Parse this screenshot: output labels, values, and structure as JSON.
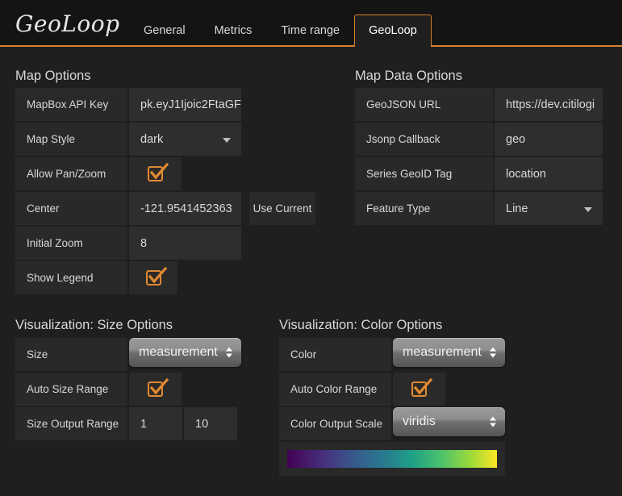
{
  "header": {
    "logo": "GeoLoop",
    "tabs": [
      {
        "label": "General",
        "active": false
      },
      {
        "label": "Metrics",
        "active": false
      },
      {
        "label": "Time range",
        "active": false
      },
      {
        "label": "GeoLoop",
        "active": true
      }
    ]
  },
  "accent_color": "#d9822b",
  "map_options": {
    "title": "Map Options",
    "rows": [
      {
        "label": "MapBox API Key",
        "value": "pk.eyJ1Ijoic2FtaGF"
      },
      {
        "label": "Map Style",
        "value": "dark"
      },
      {
        "label": "Allow Pan/Zoom",
        "checked": true
      },
      {
        "label": "Center",
        "value": "-121.9541452363",
        "button": "Use Current"
      },
      {
        "label": "Initial Zoom",
        "value": "8"
      },
      {
        "label": "Show Legend",
        "checked": true
      }
    ]
  },
  "map_data_options": {
    "title": "Map Data Options",
    "rows": [
      {
        "label": "GeoJSON URL",
        "value": "https://dev.citilogi"
      },
      {
        "label": "Jsonp Callback",
        "value": "geo"
      },
      {
        "label": "Series GeoID Tag",
        "value": "location"
      },
      {
        "label": "Feature Type",
        "value": "Line"
      }
    ]
  },
  "size_options": {
    "title": "Visualization: Size Options",
    "size_label": "Size",
    "size_value": "measurement",
    "auto_label": "Auto Size Range",
    "auto_checked": true,
    "range_label": "Size Output Range",
    "range_min": "1",
    "range_max": "10"
  },
  "color_options": {
    "title": "Visualization: Color Options",
    "color_label": "Color",
    "color_value": "measurement",
    "auto_label": "Auto Color Range",
    "auto_checked": true,
    "scale_label": "Color Output Scale",
    "scale_value": "viridis",
    "gradient_name": "viridis",
    "gradient_stops": [
      "#440154",
      "#46327e",
      "#365c8d",
      "#277f8e",
      "#1fa187",
      "#4ac16d",
      "#a0da39",
      "#fde725"
    ]
  }
}
